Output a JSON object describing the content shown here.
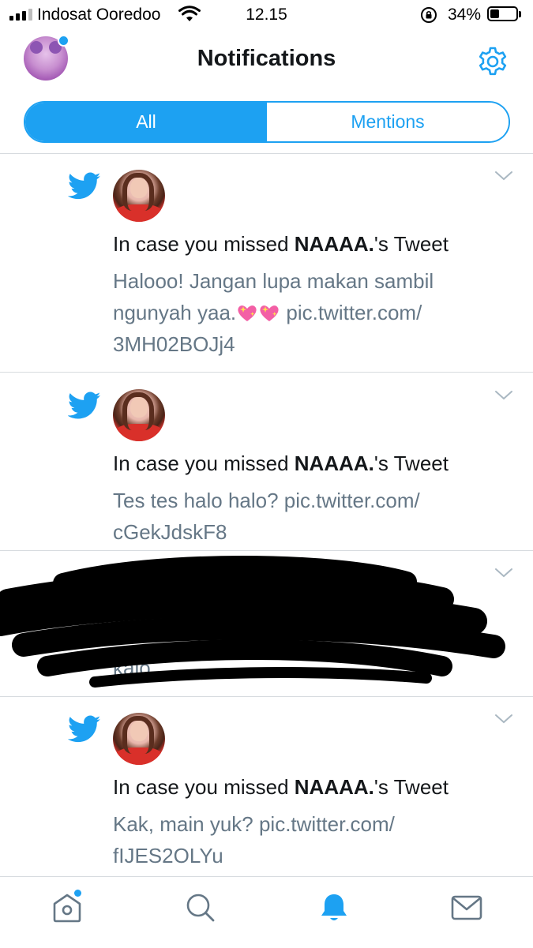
{
  "status_bar": {
    "carrier": "Indosat Ooredoo",
    "time": "12.15",
    "battery_percent": "34%",
    "battery_level": 0.34,
    "signal_bars": 3
  },
  "header": {
    "title": "Notifications",
    "settings_icon": "gear-icon",
    "avatar_has_badge": true
  },
  "tabs": [
    {
      "label": "All",
      "active": true
    },
    {
      "label": "Mentions",
      "active": false
    }
  ],
  "notifications": [
    {
      "icon": "twitter-bird-icon",
      "prefix": "In case you missed ",
      "author": "NAAAA.",
      "suffix": "'s Tweet",
      "text_before": "Halooo! Jangan lupa makan sambil ngunyah yaa.",
      "emoji": [
        "sparkling-heart",
        "sparkling-heart"
      ],
      "text_after": " pic.twitter.com/ 3MH02BOJj4"
    },
    {
      "icon": "twitter-bird-icon",
      "prefix": "In case you missed ",
      "author": "NAAAA.",
      "suffix": "'s Tweet",
      "text": "Tes tes halo halo? pic.twitter.com/ cGekJdskF8"
    },
    {
      "redacted": true,
      "visible_fragment": "kalo"
    },
    {
      "icon": "twitter-bird-icon",
      "prefix": "In case you missed ",
      "author": "NAAAA.",
      "suffix": "'s Tweet",
      "text": "Kak, main yuk? pic.twitter.com/ fIJES2OLYu"
    }
  ],
  "tab_bar": [
    {
      "icon": "home-icon",
      "active": false,
      "badge": true
    },
    {
      "icon": "search-icon",
      "active": false,
      "badge": false
    },
    {
      "icon": "bell-icon",
      "active": true,
      "badge": false
    },
    {
      "icon": "mail-icon",
      "active": false,
      "badge": false
    }
  ],
  "colors": {
    "accent": "#1da1f2",
    "secondary_text": "#657786",
    "divider": "#d7dbdf"
  }
}
